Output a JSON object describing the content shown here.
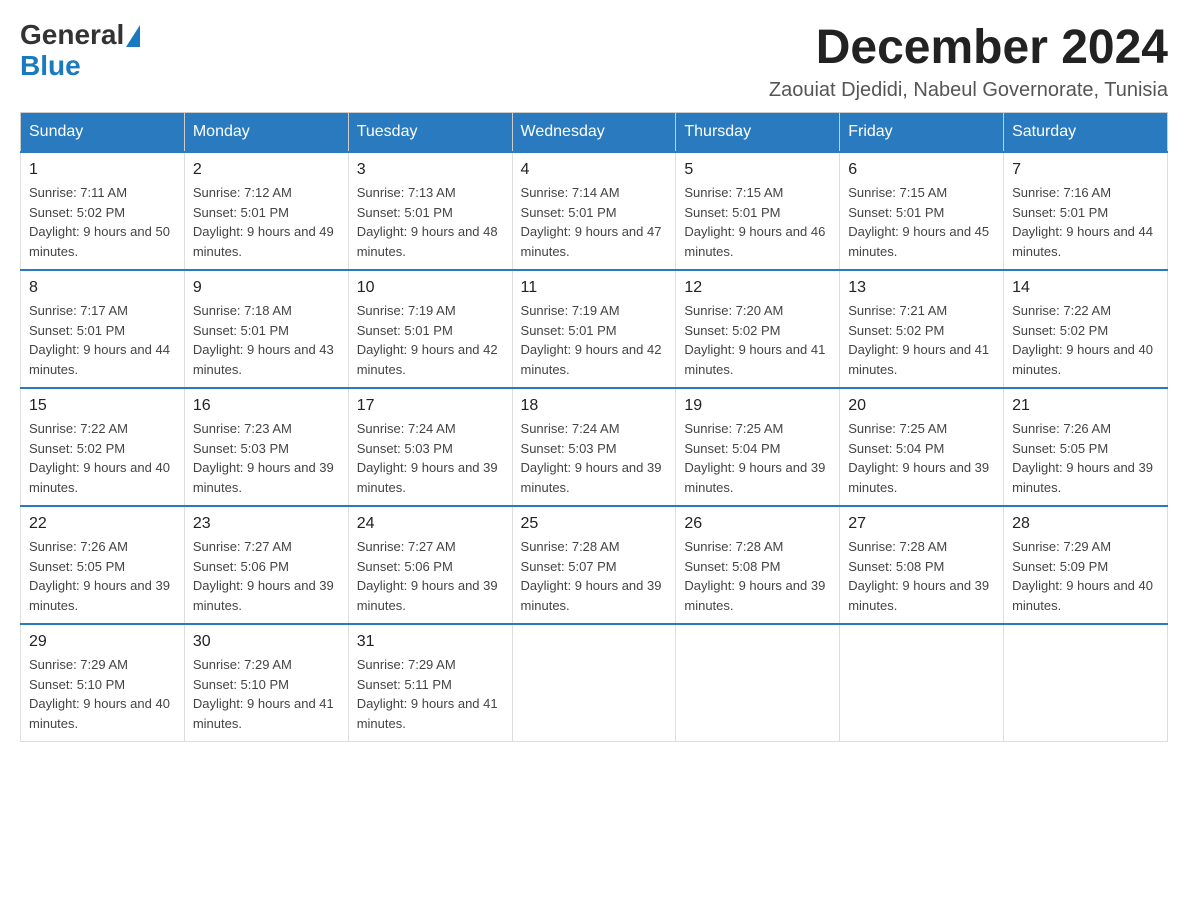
{
  "header": {
    "logo_general": "General",
    "logo_blue": "Blue",
    "month_title": "December 2024",
    "location": "Zaouiat Djedidi, Nabeul Governorate, Tunisia"
  },
  "days_of_week": [
    "Sunday",
    "Monday",
    "Tuesday",
    "Wednesday",
    "Thursday",
    "Friday",
    "Saturday"
  ],
  "weeks": [
    [
      {
        "day": "1",
        "sunrise": "7:11 AM",
        "sunset": "5:02 PM",
        "daylight": "9 hours and 50 minutes."
      },
      {
        "day": "2",
        "sunrise": "7:12 AM",
        "sunset": "5:01 PM",
        "daylight": "9 hours and 49 minutes."
      },
      {
        "day": "3",
        "sunrise": "7:13 AM",
        "sunset": "5:01 PM",
        "daylight": "9 hours and 48 minutes."
      },
      {
        "day": "4",
        "sunrise": "7:14 AM",
        "sunset": "5:01 PM",
        "daylight": "9 hours and 47 minutes."
      },
      {
        "day": "5",
        "sunrise": "7:15 AM",
        "sunset": "5:01 PM",
        "daylight": "9 hours and 46 minutes."
      },
      {
        "day": "6",
        "sunrise": "7:15 AM",
        "sunset": "5:01 PM",
        "daylight": "9 hours and 45 minutes."
      },
      {
        "day": "7",
        "sunrise": "7:16 AM",
        "sunset": "5:01 PM",
        "daylight": "9 hours and 44 minutes."
      }
    ],
    [
      {
        "day": "8",
        "sunrise": "7:17 AM",
        "sunset": "5:01 PM",
        "daylight": "9 hours and 44 minutes."
      },
      {
        "day": "9",
        "sunrise": "7:18 AM",
        "sunset": "5:01 PM",
        "daylight": "9 hours and 43 minutes."
      },
      {
        "day": "10",
        "sunrise": "7:19 AM",
        "sunset": "5:01 PM",
        "daylight": "9 hours and 42 minutes."
      },
      {
        "day": "11",
        "sunrise": "7:19 AM",
        "sunset": "5:01 PM",
        "daylight": "9 hours and 42 minutes."
      },
      {
        "day": "12",
        "sunrise": "7:20 AM",
        "sunset": "5:02 PM",
        "daylight": "9 hours and 41 minutes."
      },
      {
        "day": "13",
        "sunrise": "7:21 AM",
        "sunset": "5:02 PM",
        "daylight": "9 hours and 41 minutes."
      },
      {
        "day": "14",
        "sunrise": "7:22 AM",
        "sunset": "5:02 PM",
        "daylight": "9 hours and 40 minutes."
      }
    ],
    [
      {
        "day": "15",
        "sunrise": "7:22 AM",
        "sunset": "5:02 PM",
        "daylight": "9 hours and 40 minutes."
      },
      {
        "day": "16",
        "sunrise": "7:23 AM",
        "sunset": "5:03 PM",
        "daylight": "9 hours and 39 minutes."
      },
      {
        "day": "17",
        "sunrise": "7:24 AM",
        "sunset": "5:03 PM",
        "daylight": "9 hours and 39 minutes."
      },
      {
        "day": "18",
        "sunrise": "7:24 AM",
        "sunset": "5:03 PM",
        "daylight": "9 hours and 39 minutes."
      },
      {
        "day": "19",
        "sunrise": "7:25 AM",
        "sunset": "5:04 PM",
        "daylight": "9 hours and 39 minutes."
      },
      {
        "day": "20",
        "sunrise": "7:25 AM",
        "sunset": "5:04 PM",
        "daylight": "9 hours and 39 minutes."
      },
      {
        "day": "21",
        "sunrise": "7:26 AM",
        "sunset": "5:05 PM",
        "daylight": "9 hours and 39 minutes."
      }
    ],
    [
      {
        "day": "22",
        "sunrise": "7:26 AM",
        "sunset": "5:05 PM",
        "daylight": "9 hours and 39 minutes."
      },
      {
        "day": "23",
        "sunrise": "7:27 AM",
        "sunset": "5:06 PM",
        "daylight": "9 hours and 39 minutes."
      },
      {
        "day": "24",
        "sunrise": "7:27 AM",
        "sunset": "5:06 PM",
        "daylight": "9 hours and 39 minutes."
      },
      {
        "day": "25",
        "sunrise": "7:28 AM",
        "sunset": "5:07 PM",
        "daylight": "9 hours and 39 minutes."
      },
      {
        "day": "26",
        "sunrise": "7:28 AM",
        "sunset": "5:08 PM",
        "daylight": "9 hours and 39 minutes."
      },
      {
        "day": "27",
        "sunrise": "7:28 AM",
        "sunset": "5:08 PM",
        "daylight": "9 hours and 39 minutes."
      },
      {
        "day": "28",
        "sunrise": "7:29 AM",
        "sunset": "5:09 PM",
        "daylight": "9 hours and 40 minutes."
      }
    ],
    [
      {
        "day": "29",
        "sunrise": "7:29 AM",
        "sunset": "5:10 PM",
        "daylight": "9 hours and 40 minutes."
      },
      {
        "day": "30",
        "sunrise": "7:29 AM",
        "sunset": "5:10 PM",
        "daylight": "9 hours and 41 minutes."
      },
      {
        "day": "31",
        "sunrise": "7:29 AM",
        "sunset": "5:11 PM",
        "daylight": "9 hours and 41 minutes."
      },
      null,
      null,
      null,
      null
    ]
  ]
}
